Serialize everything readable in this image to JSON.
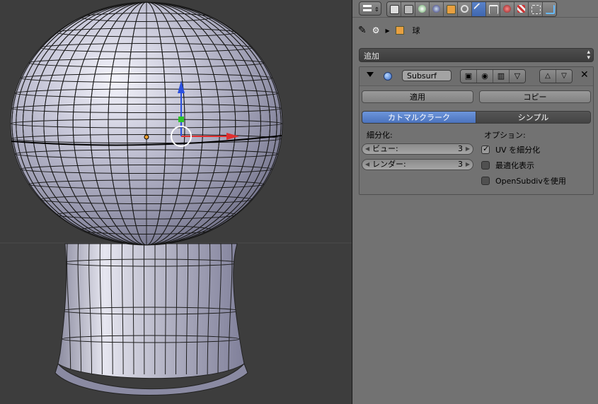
{
  "context": {
    "object_name": "球"
  },
  "add_modifier": {
    "label": "追加"
  },
  "modifier": {
    "name": "Subsurf",
    "apply_label": "適用",
    "copy_label": "コピー",
    "algorithm_options": [
      "カトマルクラーク",
      "シンプル"
    ],
    "selected_algorithm": "カトマルクラーク",
    "subdivisions_label": "細分化:",
    "view_label": "ビュー:",
    "view_value": "3",
    "render_label": "レンダー:",
    "render_value": "3",
    "options_label": "オプション:",
    "options": [
      {
        "label": "UV を細分化",
        "checked": true
      },
      {
        "label": "最適化表示",
        "checked": false
      },
      {
        "label": "OpenSubdivを使用",
        "checked": false
      }
    ]
  },
  "colors": {
    "viewport_bg": "#3d3d3d",
    "panel_bg": "#727272",
    "accent": "#5680c2",
    "axis_x": "#e03030",
    "axis_y": "#2cc42c",
    "axis_z": "#2a50e0"
  },
  "icons": [
    "editor-type-icon",
    "render-tab-icon",
    "layers-tab-icon",
    "scene-tab-icon",
    "world-tab-icon",
    "object-tab-icon",
    "constraints-tab-icon",
    "modifiers-tab-icon",
    "data-tab-icon",
    "material-tab-icon",
    "texture-tab-icon",
    "particles-tab-icon",
    "physics-tab-icon",
    "pin-icon",
    "modifier-wrench-icon",
    "cube-icon"
  ]
}
